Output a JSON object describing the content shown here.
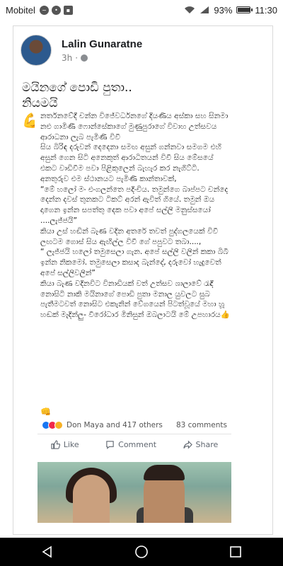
{
  "status_bar": {
    "carrier": "Mobitel",
    "battery": "93%",
    "battery_level": 0.93,
    "time": "11:30"
  },
  "post": {
    "author": "Lalin Gunaratne",
    "time": "3h",
    "caption_line1": "මයිනගේ පොඩි පුතා..",
    "caption_line2": "නියමයි",
    "caption_emojis": "💪💪💪"
  },
  "shared": {
    "paragraphs": [
      "නර්තනවේදී චන්න විජේවර්ධනගේ දියණිය අස්කා සහ සිනමා නළු ගාමිණී ෆොන්සේකාගේ මුණුපුරාගේ විවාහ උත්සවය ආරාධනා ලැබ පැමිණි විවී",
      " සිය බිරිඳ දරුවන් දෙදෙනා සමඟ අසුන් ගන්නවා සමගම එහි අසුන් ගෙන සිටි අනෙකුත් ආරාධිතයන් විවී සිය මේසයේ එකට වාඩිවීම පවා පිළිකුලෙන් බැහැර කර නැගිට්ටි.",
      "අනතුරුව එම ස්ථානයට පැමිණි කාන්තාවක්,",
      "“මේ හලෝ මං එංගලන්තෙ පදිංචිය. තමුන්ගෙ බාප්පට චන්දෙ දෙන්න දවස් තුනකට ටිකට් අරන් ඇවිත් ගියේ. තමුන් ඔය දාගෙන ඉන්න සපත්තු දෙක පවා අපේ සල්ලි මනුස්සයෝ ....ලැජ්ජයි”",
      "කියා උස් හඬින් බැණ වදින අතරේ තවත් පුද්ගලයෙක් විවී ලඟටම ගොස් සිය ඇඟිල්ල විවී ගේ පපුවට තබා....,",
      "“ ලැජ්ජයි හලෝ තමුසෙලා ගැන. අපේ සල්ලි වලින් කකා බිබී ඉන්න නිකමෝ. තමුසෙලා කසාද බැන්දේ, දරුවෝ හැදුවෙත් අපේ සල්ලිවලින්”",
      "කියා බැණ වදිනවිට විනාඩියක් වත් උත්සව ශාලාවේ රැඳී නොසිටි නාකි මයිනාගේ පොඩි පුතා මනාල යුවලට සුබ පැතීමටවත් නොසිට එකැනින් වේගයෙන් පිටත්වූයේ මහා හූ හඬක් මැදින්ලු- වීරෝධාර මිනිසුන් ඔබලාටයි මේ උපහාරය👍"
    ],
    "thumb_emoji": "👊",
    "reactions_text": "Don Maya and 417 others",
    "comments_text": "83 comments",
    "like_label": "Like",
    "comment_label": "Comment",
    "share_label": "Share"
  },
  "colors": {
    "like_blue": "#1877f2",
    "love_red": "#f0284a",
    "haha_yellow": "#f7b125",
    "nav_black": "#000000"
  },
  "icons": [
    "messenger-icon",
    "message-icon",
    "image-icon",
    "wifi-icon",
    "signal-icon",
    "battery-icon",
    "globe-icon",
    "like-icon",
    "comment-icon",
    "share-icon",
    "back-icon",
    "home-icon",
    "recents-icon"
  ]
}
